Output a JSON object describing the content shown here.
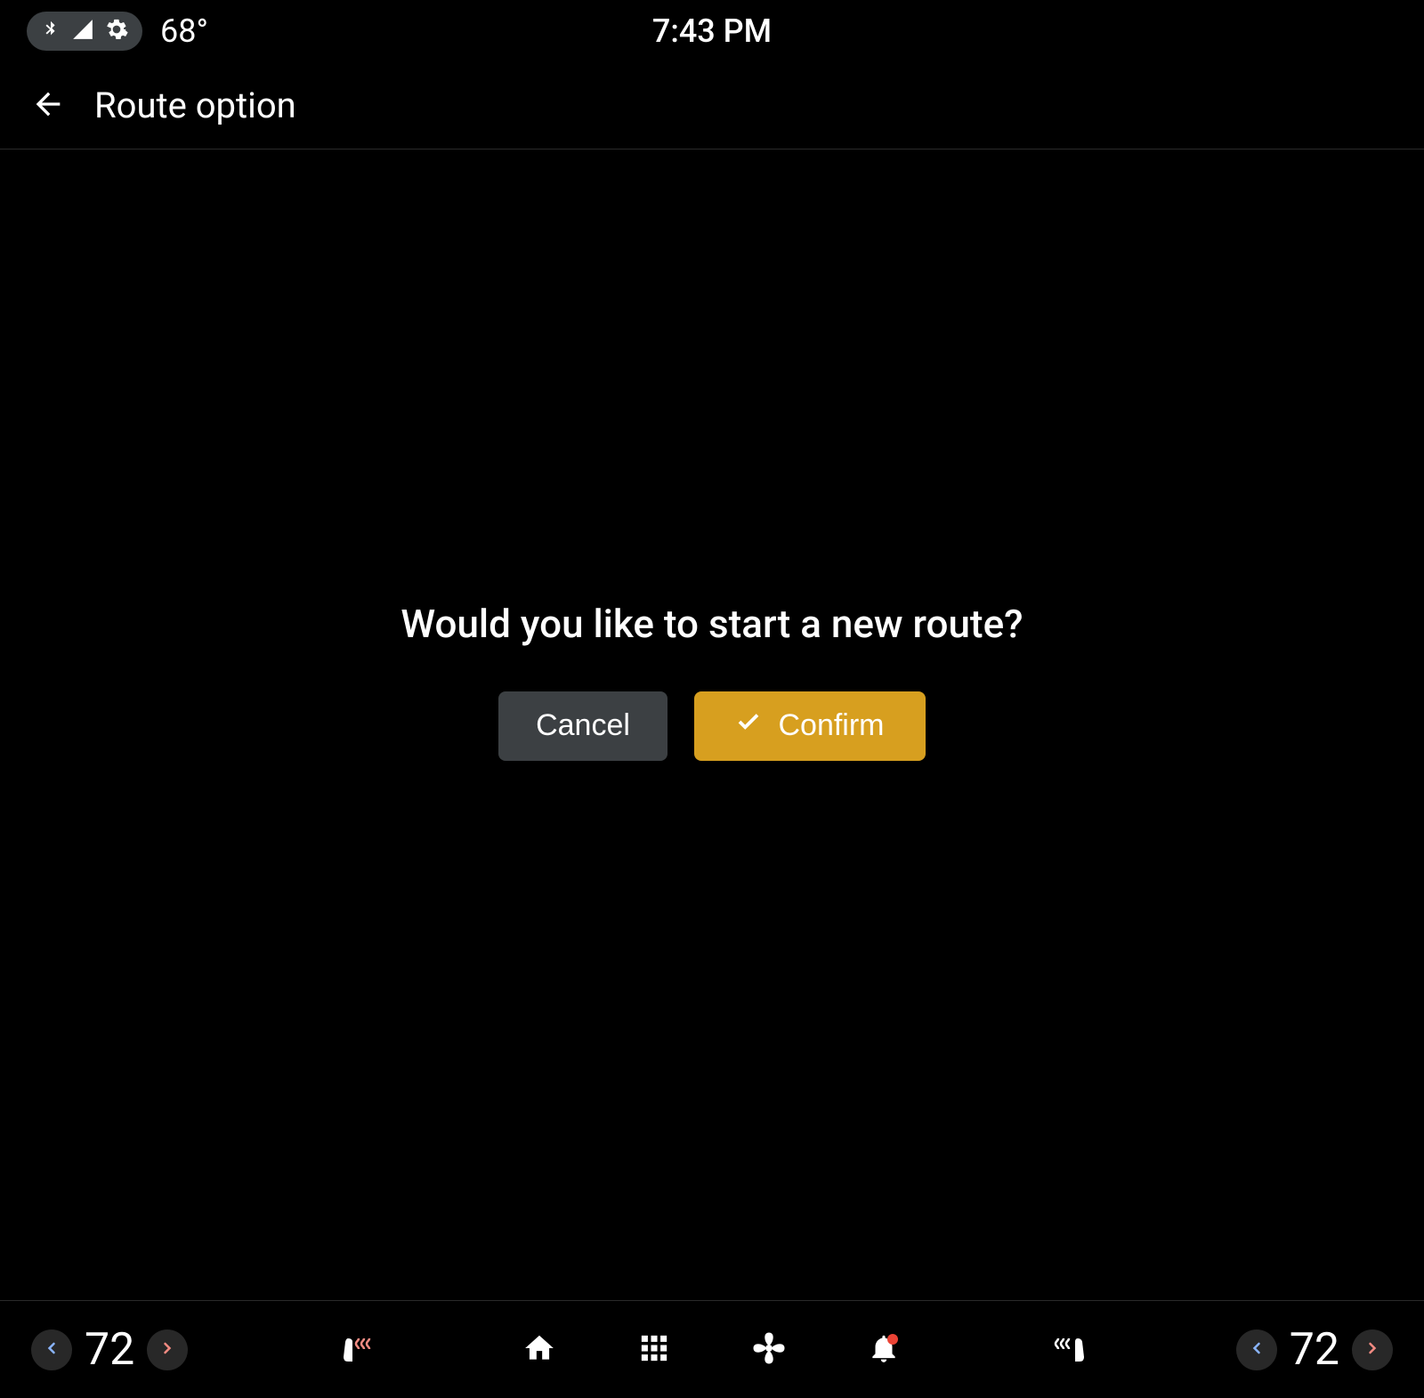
{
  "status_bar": {
    "outside_temp": "68°",
    "clock": "7:43 PM"
  },
  "header": {
    "title": "Route option"
  },
  "dialog": {
    "prompt": "Would you like to start a new route?",
    "cancel_label": "Cancel",
    "confirm_label": "Confirm"
  },
  "bottom_bar": {
    "left_temp": "72",
    "right_temp": "72"
  },
  "colors": {
    "accent": "#d79f1f",
    "chev_left": "#8ab4f8",
    "chev_right": "#f28b82",
    "notif_dot": "#ea4335"
  }
}
